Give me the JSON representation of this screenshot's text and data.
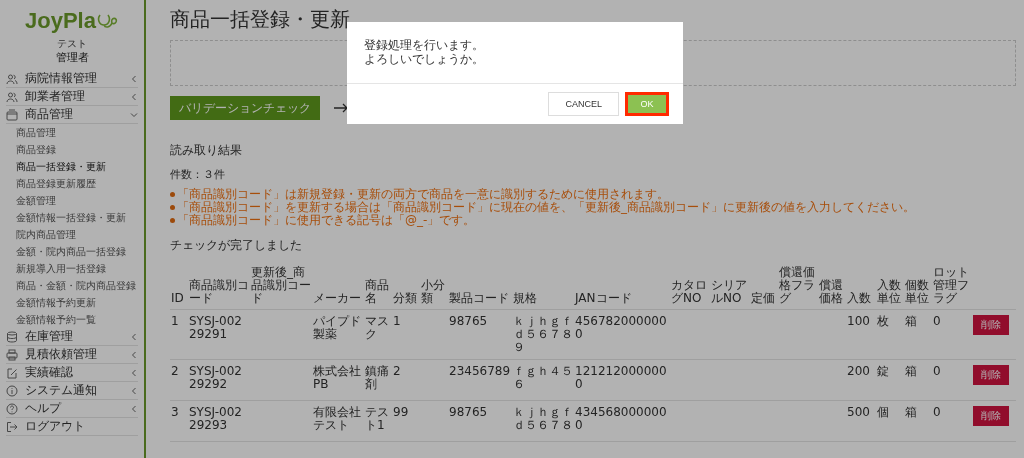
{
  "sidebar": {
    "logo": "JoyPla",
    "user_name": "テスト",
    "user_role": "管理者",
    "nav": [
      {
        "kind": "group",
        "label": "病院情報管理",
        "expanded": false
      },
      {
        "kind": "group",
        "label": "卸業者管理",
        "expanded": false
      },
      {
        "kind": "group",
        "label": "商品管理",
        "expanded": true,
        "children": [
          {
            "label": "商品管理",
            "selected": false
          },
          {
            "label": "商品登録",
            "selected": false
          },
          {
            "label": "商品一括登録・更新",
            "selected": true
          },
          {
            "label": "商品登録更新履歴",
            "selected": false
          },
          {
            "label": "金額管理",
            "selected": false
          },
          {
            "label": "金額情報一括登録・更新",
            "selected": false
          },
          {
            "label": "院内商品管理",
            "selected": false
          },
          {
            "label": "金額・院内商品一括登録",
            "selected": false
          },
          {
            "label": "新規導入用一括登録",
            "selected": false
          },
          {
            "label": "商品・金額・院内商品登録",
            "selected": false
          },
          {
            "label": "金額情報予約更新",
            "selected": false
          },
          {
            "label": "金額情報予約一覧",
            "selected": false
          }
        ]
      },
      {
        "kind": "group",
        "label": "在庫管理",
        "expanded": false
      },
      {
        "kind": "group",
        "label": "見積依頼管理",
        "expanded": false
      },
      {
        "kind": "group",
        "label": "実績確認",
        "expanded": false
      },
      {
        "kind": "group",
        "label": "システム通知",
        "expanded": false
      },
      {
        "kind": "group",
        "label": "ヘルプ",
        "expanded": false
      },
      {
        "kind": "link",
        "label": "ログアウト"
      }
    ]
  },
  "page": {
    "title": "商品一括登録・更新",
    "validate_button": "バリデーションチェック",
    "section_title": "読み取り結果",
    "count": "件数：３件",
    "notes": [
      "「商品識別コード」は新規登録・更新の両方で商品を一意に識別するために使用されます。",
      "「商品識別コード」を更新する場合は「商品識別コード」に現在の値を、「更新後_商品識別コード」に更新後の値を入力してください。",
      "「商品識別コード」に使用できる記号は「@_-」です。"
    ],
    "status": "チェックが完了しました",
    "table": {
      "columns": [
        "ID",
        "商品識別コード",
        "更新後_商品識別コード",
        "メーカー",
        "商品名",
        "分類",
        "小分類",
        "製品コード",
        "規格",
        "JANコード",
        "カタログNO",
        "シリアルNO",
        "定価",
        "償還価格フラグ",
        "償還価格",
        "入数",
        "入数単位",
        "個数単位",
        "ロット管理フラグ"
      ],
      "rows": [
        {
          "cells": [
            "1",
            "SYSJ-00229291",
            null,
            "パイプド製薬",
            "マスク",
            "1",
            null,
            "98765",
            "ｋｊｈｇｆｄ５６７８９",
            "4567820000000",
            null,
            null,
            null,
            null,
            null,
            "100",
            "枚",
            "箱",
            "0"
          ],
          "action": "削除"
        },
        {
          "cells": [
            "2",
            "SYSJ-00229292",
            null,
            "株式会社PB",
            "鎮痛剤",
            "2",
            null,
            "23456789",
            "ｆｇｈ４５６",
            "1212120000000",
            null,
            null,
            null,
            null,
            null,
            "200",
            "錠",
            "箱",
            "0"
          ],
          "action": "削除"
        },
        {
          "cells": [
            "3",
            "SYSJ-00229293",
            null,
            "有限会社テスト",
            "テスト1",
            "99",
            null,
            "98765",
            "ｋｊｈｇｆｄ５６７８",
            "4345680000000",
            null,
            null,
            null,
            null,
            null,
            "500",
            "個",
            "箱",
            "0"
          ],
          "action": "削除"
        }
      ]
    }
  },
  "dialog": {
    "message_lines": [
      "登録処理を行います。",
      "よろしいでしょうか。"
    ],
    "buttons": [
      {
        "kind": "cancel",
        "label": "CANCEL",
        "highlighted": false
      },
      {
        "kind": "ok",
        "label": "OK",
        "highlighted": true
      }
    ]
  }
}
